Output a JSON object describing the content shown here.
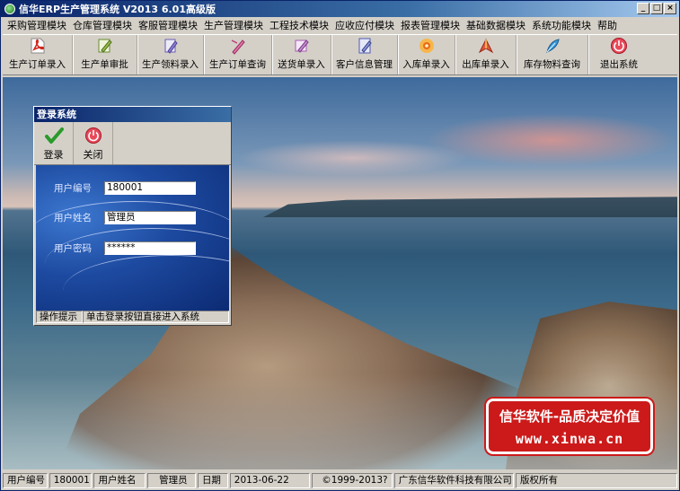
{
  "window": {
    "title": "信华ERP生产管理系统  V2013  6.01高级版"
  },
  "menu": [
    "采购管理模块",
    "仓库管理模块",
    "客服管理模块",
    "生产管理模块",
    "工程技术模块",
    "应收应付模块",
    "报表管理模块",
    "基础数据模块",
    "系统功能模块",
    "帮助"
  ],
  "toolbar": [
    {
      "label": "生产订单录入",
      "icon": "pdf-icon",
      "color": "#d0271f"
    },
    {
      "label": "生产单审批",
      "icon": "pencil-approve-icon",
      "color": "#6a8c2f"
    },
    {
      "label": "生产领料录入",
      "icon": "pencil-doc-icon",
      "color": "#6a5bb0"
    },
    {
      "label": "生产订单查询",
      "icon": "pen-query-icon",
      "color": "#c0397a"
    },
    {
      "label": "送货单录入",
      "icon": "delivery-pen-icon",
      "color": "#a858b4"
    },
    {
      "label": "客户信息管理",
      "icon": "notebook-icon",
      "color": "#4e5ab0"
    },
    {
      "label": "入库单录入",
      "icon": "flower-icon",
      "color": "#e89018"
    },
    {
      "label": "出库单录入",
      "icon": "arrow-feather-icon",
      "color": "#d63a2a"
    },
    {
      "label": "库存物料查询",
      "icon": "feather-icon",
      "color": "#2a86c8"
    },
    {
      "label": "退出系统",
      "icon": "power-icon",
      "color": "#d8283a"
    }
  ],
  "brand": {
    "line1": "信华软件-品质决定价值",
    "line2": "www.xinwa.cn"
  },
  "login": {
    "title": "登录系统",
    "login_label": "登录",
    "close_label": "关闭",
    "fields": [
      {
        "label": "用户编号",
        "value": "180001"
      },
      {
        "label": "用户姓名",
        "value": "管理员"
      },
      {
        "label": "用户密码",
        "value": "******"
      }
    ],
    "hint_label": "操作提示",
    "hint_text": "单击登录按钮直接进入系统"
  },
  "status": {
    "user_id_label": "用户编号",
    "user_id": "180001",
    "user_name_label": "用户姓名",
    "user_name": "管理员",
    "date_label": "日期",
    "date": "2013-06-22",
    "copyright": "©1999-2013?",
    "company": "广东信华软件科技有限公司",
    "rights": "版权所有"
  }
}
